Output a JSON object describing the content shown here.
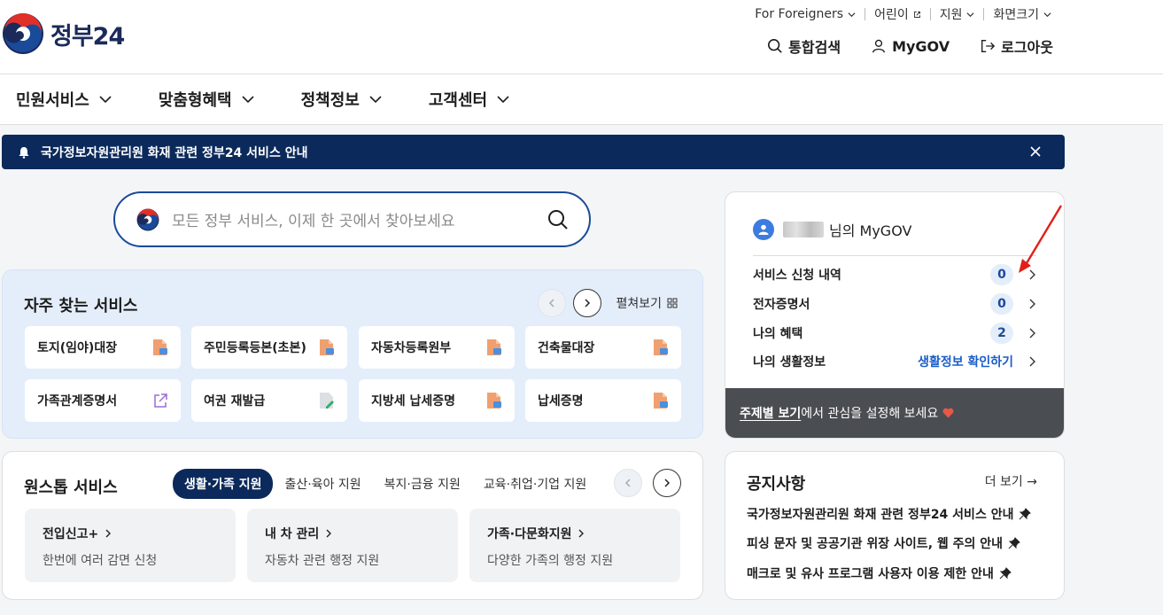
{
  "header": {
    "logo_text": "정부24",
    "util": [
      {
        "label": "For Foreigners"
      },
      {
        "label": "어린이"
      },
      {
        "label": "지원"
      },
      {
        "label": "화면크기"
      }
    ],
    "actions": [
      {
        "label": "통합검색",
        "icon": "search-icon"
      },
      {
        "label": "MyGOV",
        "icon": "user-icon"
      },
      {
        "label": "로그아웃",
        "icon": "logout-icon"
      }
    ]
  },
  "nav": [
    "민원서비스",
    "맞춤형혜택",
    "정책정보",
    "고객센터"
  ],
  "banner": {
    "text": "국가정보자원관리원 화재 관련 정부24 서비스 안내"
  },
  "search": {
    "placeholder": "모든 정부 서비스, 이제 한 곳에서 찾아보세요"
  },
  "frequent": {
    "title": "자주 찾는 서비스",
    "spread_label": "펼쳐보기",
    "items": [
      {
        "label": "토지(임야)대장",
        "icon": "document-icon"
      },
      {
        "label": "주민등록등본(초본)",
        "icon": "document-icon"
      },
      {
        "label": "자동차등록원부",
        "icon": "document-icon"
      },
      {
        "label": "건축물대장",
        "icon": "document-icon"
      },
      {
        "label": "가족관계증명서",
        "icon": "external-link-icon"
      },
      {
        "label": "여권 재발급",
        "icon": "edit-document-icon"
      },
      {
        "label": "지방세 납세증명",
        "icon": "document-icon"
      },
      {
        "label": "납세증명",
        "icon": "document-icon"
      }
    ]
  },
  "onestop": {
    "title": "원스톱 서비스",
    "tabs": [
      "생활·가족 지원",
      "출산·육아 지원",
      "복지·금융 지원",
      "교육·취업·기업 지원"
    ],
    "cards": [
      {
        "title": "전입신고+",
        "desc": "한번에 여러 감면 신청"
      },
      {
        "title": "내 차 관리",
        "desc": "자동차 관련 행정 지원"
      },
      {
        "title": "가족·다문화지원",
        "desc": "다양한 가족의 행정 지원"
      }
    ]
  },
  "mygov": {
    "greeting": "님의 MyGOV",
    "rows": [
      {
        "label": "서비스 신청 내역",
        "value": "0"
      },
      {
        "label": "전자증명서",
        "value": "0"
      },
      {
        "label": "나의 혜택",
        "value": "2"
      },
      {
        "label": "나의 생활정보",
        "value": "생활정보 확인하기"
      }
    ],
    "footer_link": "주제별 보기",
    "footer_text": "에서 관심을 설정해 보세요"
  },
  "notice": {
    "title": "공지사항",
    "more": "더 보기 →",
    "items": [
      "국가정보자원관리원 화재 관련 정부24 서비스 안내",
      "피싱 문자 및 공공기관 위장 사이트, 웹 주의 안내",
      "매크로 및 유사 프로그램 사용자 이용 제한 안내"
    ]
  },
  "colors": {
    "brand_navy": "#0b2a5b",
    "accent_blue": "#1a5dc8",
    "accent_red": "#e0302a"
  }
}
